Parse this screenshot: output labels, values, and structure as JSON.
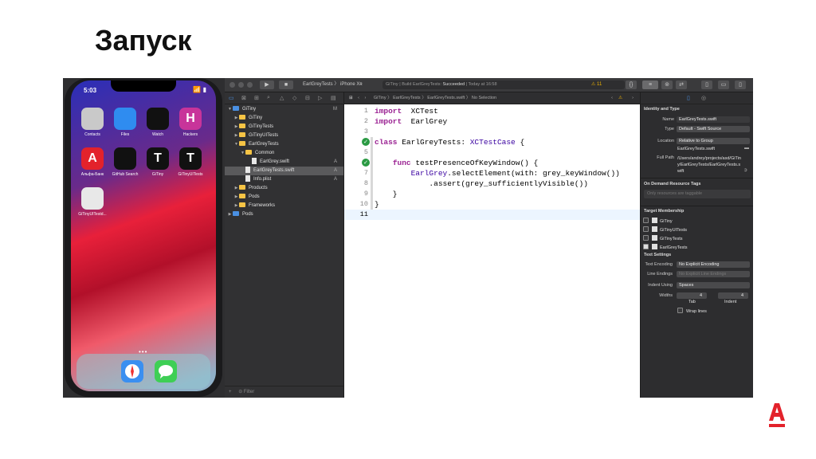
{
  "slide": {
    "title": "Запуск"
  },
  "phone": {
    "time": "5:03",
    "status_icons": "📶 ▮",
    "apps": [
      {
        "label": "Contacts",
        "color": "#c9c9c9"
      },
      {
        "label": "Files",
        "color": "#2f8cf0"
      },
      {
        "label": "Watch",
        "color": "#111111"
      },
      {
        "label": "Hackers",
        "color": "#c8349a",
        "glyph": "H"
      },
      {
        "label": "Альфа-Банк",
        "color": "#e3222b",
        "glyph": "A"
      },
      {
        "label": "GitHub Search",
        "color": "#111111"
      },
      {
        "label": "GiTiny",
        "color": "#111111",
        "glyph": "T"
      },
      {
        "label": "GiTinyUITests",
        "color": "#111111",
        "glyph": "T"
      },
      {
        "label": "GiTinyUITestd...",
        "color": "#e8e8e8"
      }
    ],
    "page_dots": "•••",
    "dock": [
      {
        "name": "safari",
        "color": "#3a8ff0"
      },
      {
        "name": "messages",
        "color": "#3ecf55"
      }
    ]
  },
  "xcode": {
    "toolbar": {
      "scheme": "EarlGreyTests",
      "device": "iPhone Xʀ",
      "activity_app": "GiTiny",
      "activity_status": "Build EarlGreyTests: ",
      "activity_result": "Succeeded",
      "activity_time": "Today at 16:58",
      "warning_count": "11"
    },
    "navigator": {
      "rows": [
        {
          "label": "GiTiny",
          "indent": 0,
          "arrow": "▼",
          "type": "project",
          "badge": "M"
        },
        {
          "label": "GiTiny",
          "indent": 1,
          "arrow": "▶",
          "type": "folder",
          "badge": ""
        },
        {
          "label": "GiTinyTests",
          "indent": 1,
          "arrow": "▶",
          "type": "folder",
          "badge": ""
        },
        {
          "label": "GiTinyUITests",
          "indent": 1,
          "arrow": "▶",
          "type": "folder",
          "badge": ""
        },
        {
          "label": "EarlGreyTests",
          "indent": 1,
          "arrow": "▼",
          "type": "folder",
          "badge": ""
        },
        {
          "label": "Common",
          "indent": 2,
          "arrow": "▼",
          "type": "folder",
          "badge": ""
        },
        {
          "label": "EarlGrey.swift",
          "indent": 3,
          "arrow": "",
          "type": "file",
          "badge": "A"
        },
        {
          "label": "EarlGreyTests.swift",
          "indent": 2,
          "arrow": "",
          "type": "file",
          "badge": "A",
          "selected": true
        },
        {
          "label": "Info.plist",
          "indent": 2,
          "arrow": "",
          "type": "file",
          "badge": "A"
        },
        {
          "label": "Products",
          "indent": 1,
          "arrow": "▶",
          "type": "folder",
          "badge": ""
        },
        {
          "label": "Pods",
          "indent": 1,
          "arrow": "▶",
          "type": "folder",
          "badge": ""
        },
        {
          "label": "Frameworks",
          "indent": 1,
          "arrow": "▶",
          "type": "folder",
          "badge": ""
        },
        {
          "label": "Pods",
          "indent": 0,
          "arrow": "▶",
          "type": "project",
          "badge": ""
        }
      ],
      "filter_placeholder": "Filter"
    },
    "jumpbar": {
      "crumbs": [
        "GiTiny",
        "EarlGreyTests",
        "EarlGreyTests.swift",
        "No Selection"
      ]
    },
    "code": [
      {
        "n": "1",
        "tokens": [
          [
            "kw",
            "import"
          ],
          [
            "",
            "  XCTest"
          ]
        ]
      },
      {
        "n": "2",
        "tokens": [
          [
            "kw",
            "import"
          ],
          [
            "",
            "  EarlGrey"
          ]
        ]
      },
      {
        "n": "3",
        "tokens": []
      },
      {
        "n": "4",
        "tokens": [
          [
            "kw",
            "class"
          ],
          [
            "",
            " EarlGreyTests: "
          ],
          [
            "ty",
            "XCTestCase"
          ],
          [
            "",
            " {"
          ]
        ],
        "check": true
      },
      {
        "n": "5",
        "tokens": []
      },
      {
        "n": "6",
        "tokens": [
          [
            "",
            "    "
          ],
          [
            "kw",
            "func"
          ],
          [
            "",
            " testPresenceOfKeyWindow() {"
          ]
        ],
        "check": true
      },
      {
        "n": "7",
        "tokens": [
          [
            "",
            "        "
          ],
          [
            "ty",
            "EarlGrey"
          ],
          [
            ".",
            ".selectElement(with: grey_keyWindow())"
          ]
        ]
      },
      {
        "n": "8",
        "tokens": [
          [
            "",
            "            .assert(grey_sufficientlyVisible())"
          ]
        ]
      },
      {
        "n": "9",
        "tokens": [
          [
            "",
            "    }"
          ]
        ]
      },
      {
        "n": "10",
        "tokens": [
          [
            "",
            "}"
          ]
        ]
      },
      {
        "n": "11",
        "tokens": [],
        "current": true
      }
    ],
    "inspector": {
      "identity_header": "Identity and Type",
      "name_label": "Name",
      "name_value": "EarlGreyTests.swift",
      "type_label": "Type",
      "type_value": "Default - Swift Source",
      "location_label": "Location",
      "location_value": "Relative to Group",
      "location_file": "EarlGreyTests.swift",
      "fullpath_label": "Full Path",
      "fullpath_value": "/Users/andrey/projects/asd/GiTiny/EarlGreyTests/EarlGreyTests.swift",
      "odr_header": "On Demand Resource Tags",
      "odr_placeholder": "Only resources are taggable",
      "tm_header": "Target Membership",
      "targets": [
        {
          "label": "GiTiny",
          "checked": false
        },
        {
          "label": "GiTinyUITests",
          "checked": false
        },
        {
          "label": "GiTinyTests",
          "checked": false
        },
        {
          "label": "EarlGreyTests",
          "checked": true
        }
      ],
      "text_header": "Text Settings",
      "encoding_label": "Text Encoding",
      "encoding_value": "No Explicit Encoding",
      "endings_label": "Line Endings",
      "endings_value": "No Explicit Line Endings",
      "indent_label": "Indent Using",
      "indent_value": "Spaces",
      "widths_label": "Widths",
      "tab_value": "4",
      "indent_width_value": "4",
      "tab_caption": "Tab",
      "indent_caption": "Indent",
      "wrap_label": "Wrap lines"
    }
  }
}
